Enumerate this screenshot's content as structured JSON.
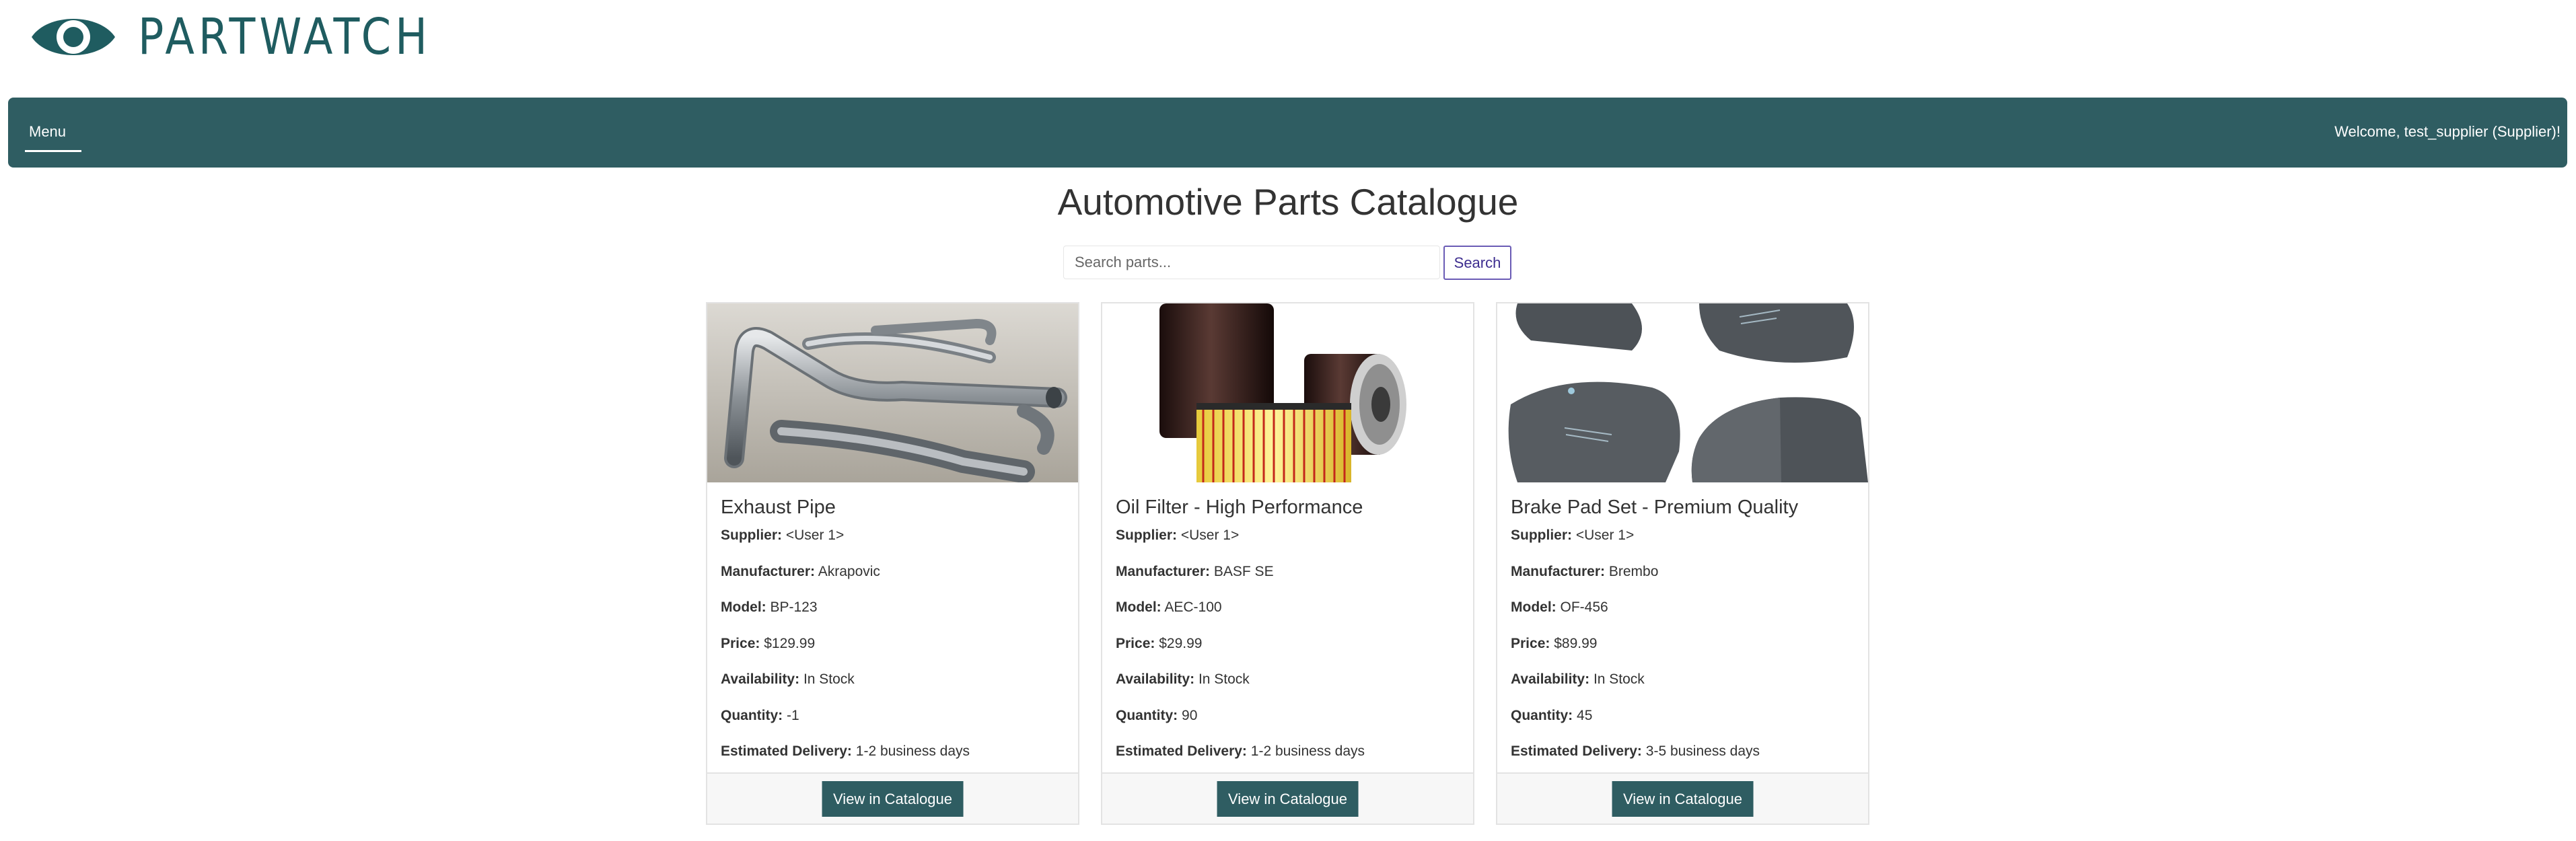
{
  "brand": {
    "name": "PARTWATCH",
    "logo_icon": "eye-icon",
    "color": "#1f5c60"
  },
  "navbar": {
    "menu_label": "Menu",
    "welcome": "Welcome, test_supplier (Supplier)!",
    "background": "#2f5d62"
  },
  "page": {
    "title": "Automotive Parts Catalogue"
  },
  "search": {
    "placeholder": "Search parts...",
    "button_label": "Search"
  },
  "labels": {
    "supplier": "Supplier:",
    "manufacturer": "Manufacturer:",
    "model": "Model:",
    "price": "Price:",
    "availability": "Availability:",
    "quantity": "Quantity:",
    "delivery": "Estimated Delivery:"
  },
  "parts": [
    {
      "title": "Exhaust Pipe",
      "supplier": "<User 1>",
      "manufacturer": "Akrapovic",
      "model": "BP-123",
      "price": "$129.99",
      "availability": "In Stock",
      "quantity": "-1",
      "delivery": "1-2 business days",
      "button": "View in Catalogue",
      "image": "exhaust-pipe-photo"
    },
    {
      "title": "Oil Filter - High Performance",
      "supplier": "<User 1>",
      "manufacturer": "BASF SE",
      "model": "AEC-100",
      "price": "$29.99",
      "availability": "In Stock",
      "quantity": "90",
      "delivery": "1-2 business days",
      "button": "View in Catalogue",
      "image": "oil-filter-photo"
    },
    {
      "title": "Brake Pad Set - Premium Quality",
      "supplier": "<User 1>",
      "manufacturer": "Brembo",
      "model": "OF-456",
      "price": "$89.99",
      "availability": "In Stock",
      "quantity": "45",
      "delivery": "3-5 business days",
      "button": "View in Catalogue",
      "image": "brake-pads-photo"
    }
  ]
}
